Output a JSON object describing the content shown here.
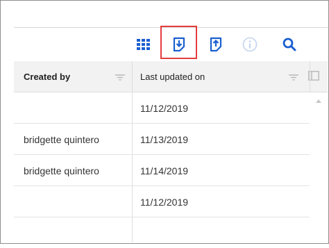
{
  "toolbar": {
    "icons": [
      "grid-view-icon",
      "export-icon",
      "import-icon",
      "info-icon",
      "search-icon"
    ],
    "accent_color": "#1a5fd0",
    "highlight_color": "#e53c3c"
  },
  "table": {
    "columns": [
      {
        "label": "Created by"
      },
      {
        "label": "Last updated on"
      }
    ],
    "rows": [
      {
        "created_by": "",
        "last_updated": "11/12/2019"
      },
      {
        "created_by": "bridgette quintero",
        "last_updated": "11/13/2019"
      },
      {
        "created_by": "bridgette quintero",
        "last_updated": "11/14/2019"
      },
      {
        "created_by": "",
        "last_updated": "11/12/2019"
      },
      {
        "created_by": "",
        "last_updated": ""
      }
    ]
  }
}
